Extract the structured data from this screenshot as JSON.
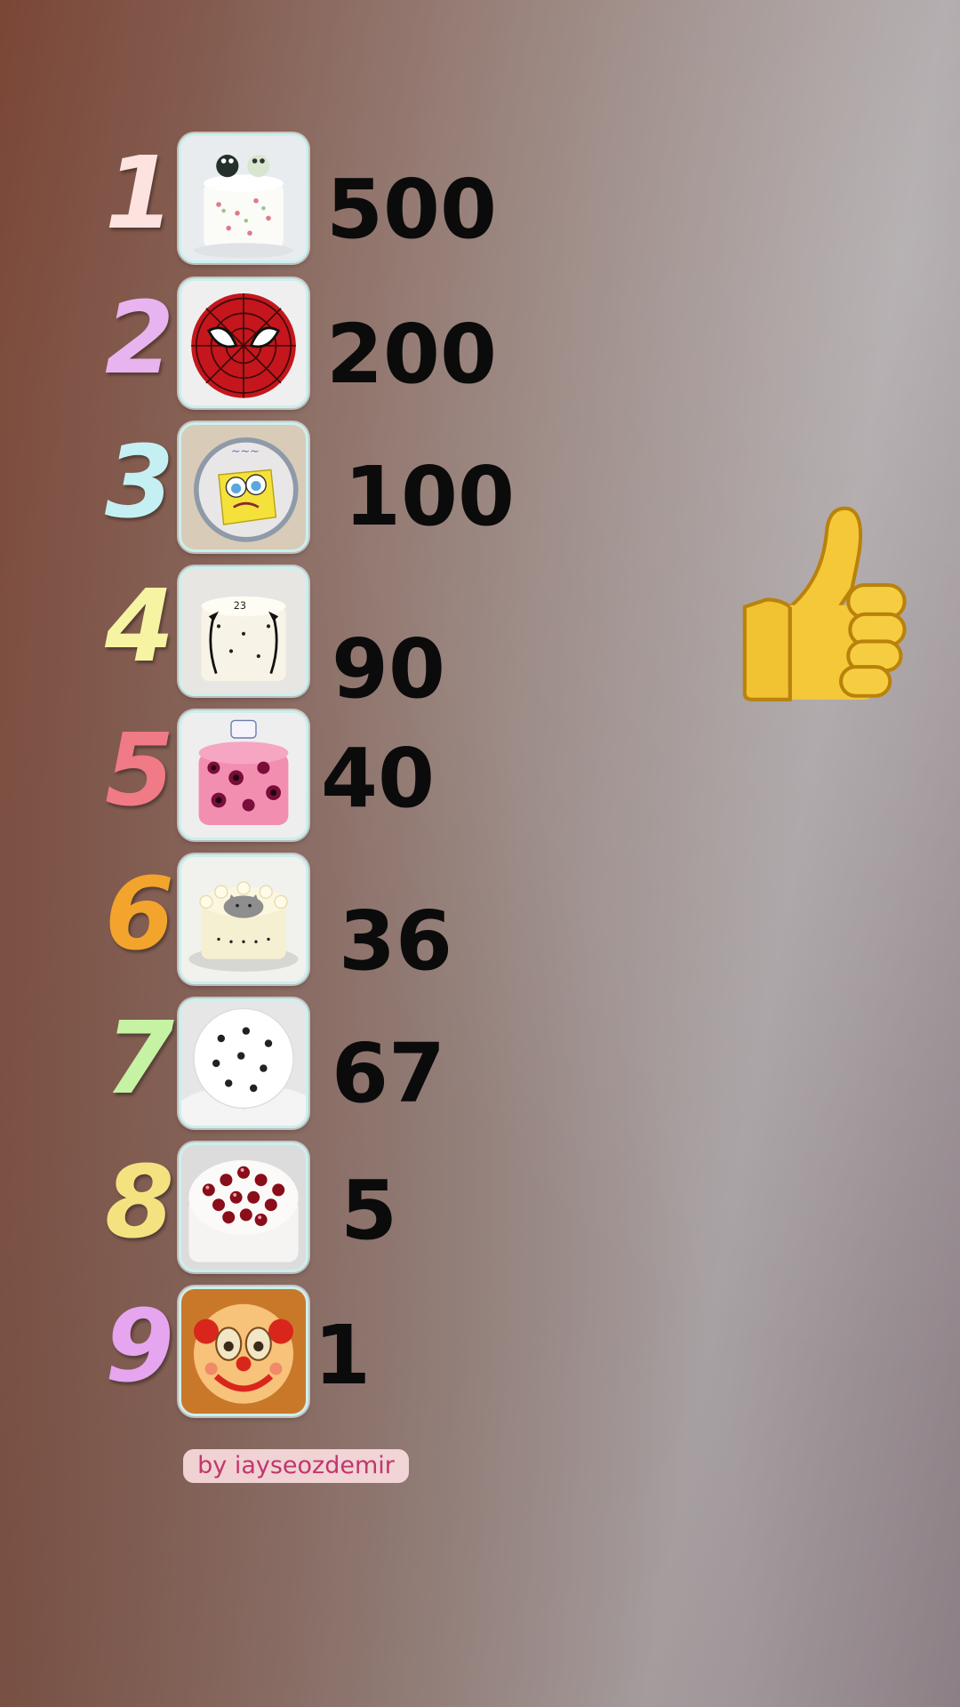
{
  "ranking": [
    {
      "rank": "1",
      "score": "500",
      "rank_color": "#fde3e0",
      "cake_icon": "frog-cake-icon"
    },
    {
      "rank": "2",
      "score": "200",
      "rank_color": "#e8b4ef",
      "cake_icon": "spiderman-cake-icon"
    },
    {
      "rank": "3",
      "score": "100",
      "rank_color": "#c4f0f3",
      "cake_icon": "spongebob-cake-icon"
    },
    {
      "rank": "4",
      "score": "90",
      "rank_color": "#f6f3a2",
      "cake_icon": "bow-cake-icon"
    },
    {
      "rank": "5",
      "score": "40",
      "rank_color": "#f07a86",
      "cake_icon": "leopard-cake-icon"
    },
    {
      "rank": "6",
      "score": "36",
      "rank_color": "#f3a42c",
      "cake_icon": "cat-cake-icon"
    },
    {
      "rank": "7",
      "score": "67",
      "rank_color": "#c6f2a4",
      "cake_icon": "paw-print-cake-icon"
    },
    {
      "rank": "8",
      "score": "5",
      "rank_color": "#f4e280",
      "cake_icon": "cherry-cake-icon"
    },
    {
      "rank": "9",
      "score": "1",
      "rank_color": "#e6a5ef",
      "cake_icon": "clown-cake-icon"
    }
  ],
  "credit": "by iayseozdemir",
  "sticker": "thumbs-up-icon"
}
